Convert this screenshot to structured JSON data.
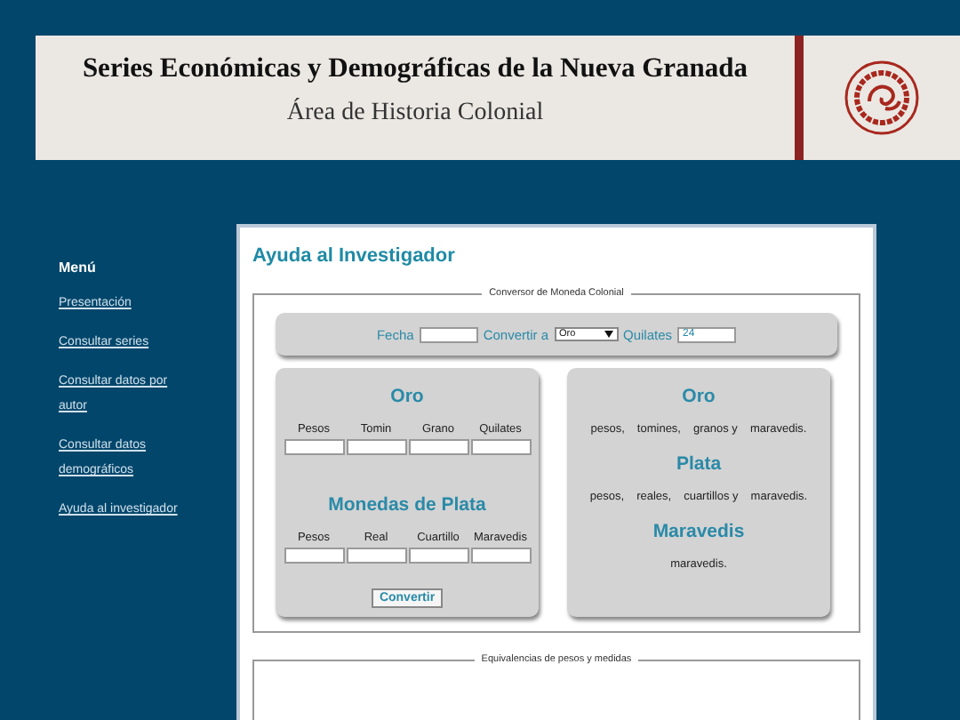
{
  "banner": {
    "title": "Series Económicas y Demográficas de la Nueva Granada",
    "subtitle": "Área de Historia Colonial"
  },
  "menu": {
    "heading": "Menú",
    "items": [
      {
        "label": "Presentación"
      },
      {
        "label": "Consultar series"
      },
      {
        "label": "Consultar datos por autor"
      },
      {
        "label": "Consultar datos demográficos"
      },
      {
        "label": "Ayuda al investigador"
      }
    ]
  },
  "page_title": "Ayuda al Investigador",
  "converter": {
    "legend": "Conversor de Moneda Colonial",
    "fecha_label": "Fecha",
    "convertir_label": "Convertir a",
    "currency": "Oro",
    "quilates_label": "Quilates",
    "quilates": "24",
    "groups": [
      {
        "title": "Oro",
        "columns": [
          "Pesos",
          "Tomin",
          "Grano",
          "Quilates"
        ]
      },
      {
        "title": "Monedas de Plata",
        "columns": [
          "Pesos",
          "Real",
          "Cuartillo",
          "Maravedis"
        ]
      }
    ],
    "button": "Convertir",
    "results": [
      {
        "title": "Oro",
        "units": [
          "pesos,",
          "tomines,",
          "granos y",
          "maravedis."
        ]
      },
      {
        "title": "Plata",
        "units": [
          "pesos,",
          "reales,",
          "cuartillos y",
          "maravedis."
        ]
      },
      {
        "title": "Maravedis",
        "units": [
          "maravedis."
        ]
      }
    ]
  },
  "equivalences": {
    "legend": "Equivalencias de pesos y medidas"
  }
}
